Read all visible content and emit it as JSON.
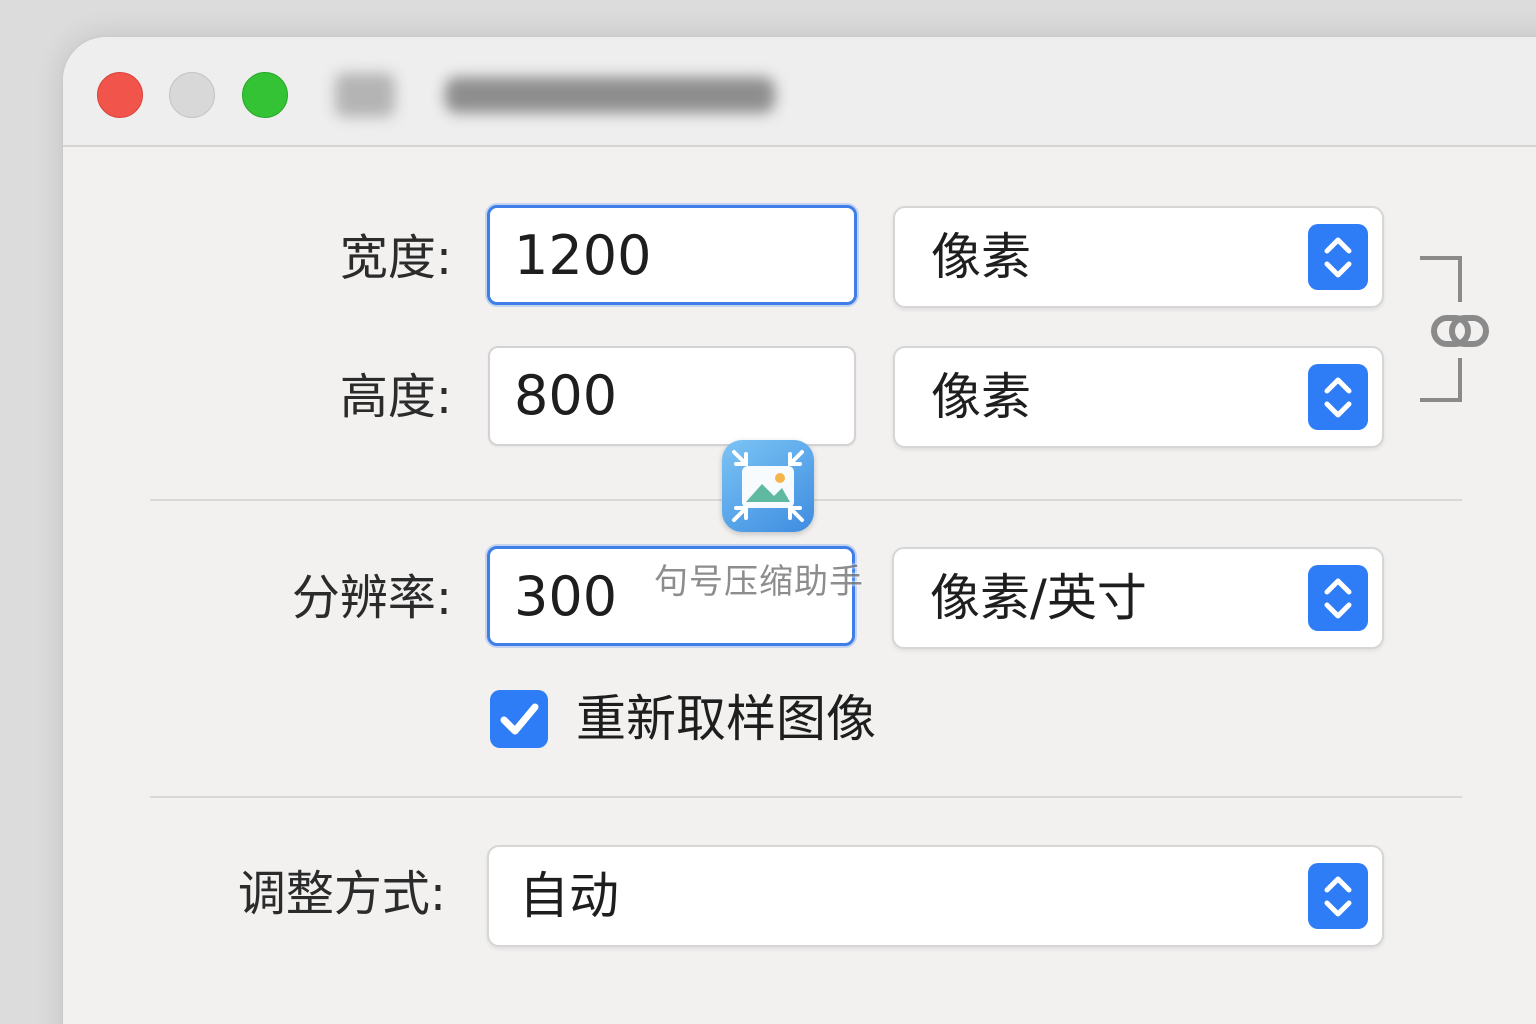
{
  "form": {
    "width": {
      "label": "宽度:",
      "value": "1200",
      "unit": "像素"
    },
    "height": {
      "label": "高度:",
      "value": "800",
      "unit": "像素"
    },
    "resolution": {
      "label": "分辨率:",
      "value": "300",
      "unit": "像素/英寸"
    },
    "resample": {
      "label": "重新取样图像",
      "checked": true
    },
    "fit": {
      "label": "调整方式:",
      "value": "自动"
    }
  },
  "watermark": {
    "text": "句号压缩助手"
  },
  "icons": {
    "stepper": "up-down-chevron-icon",
    "link": "link-icon",
    "check": "checkmark-icon",
    "app": "compress-image-icon"
  },
  "colors": {
    "accent": "#2e7cf6",
    "focus_border": "#3f7ee8",
    "close": "#f0544b",
    "minimize": "#d8d8d8",
    "maximize": "#33c335"
  }
}
